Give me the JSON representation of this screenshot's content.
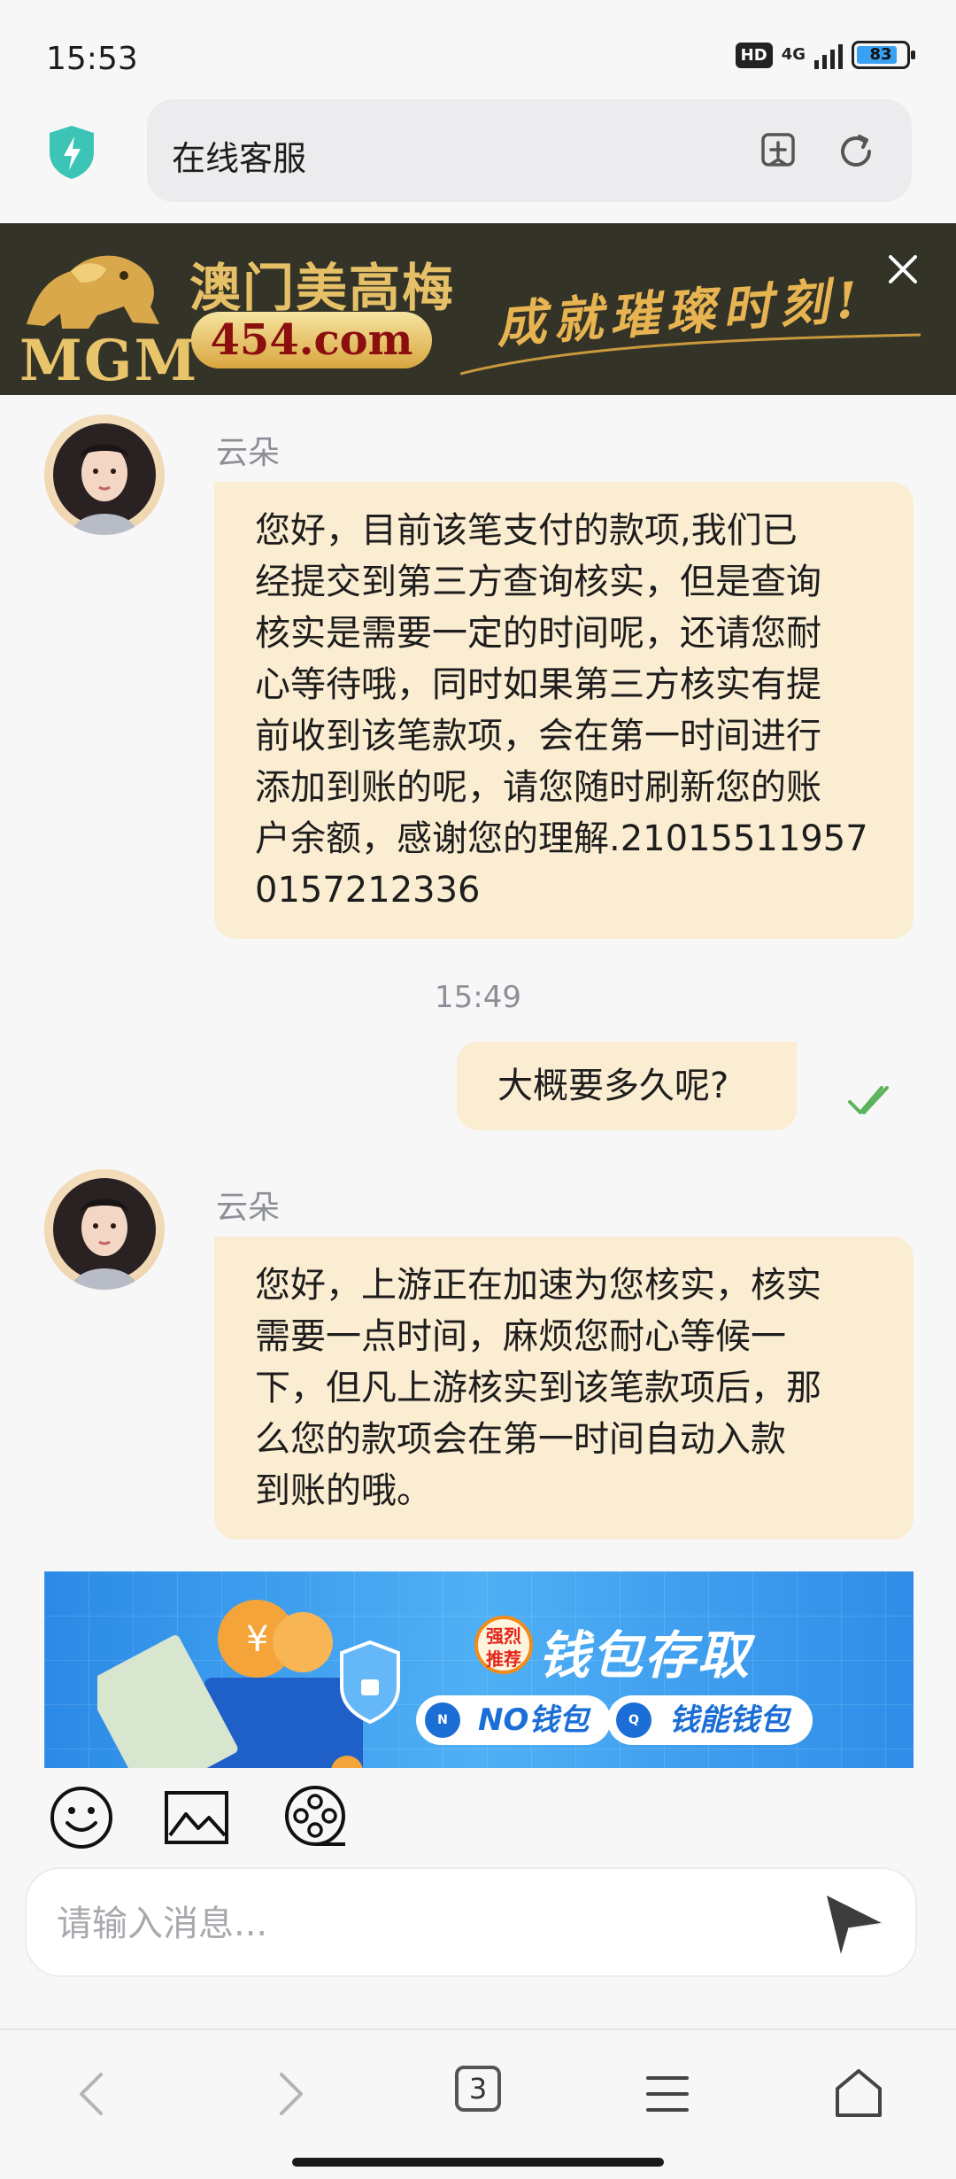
{
  "status_bar": {
    "time": "15:53",
    "hd": "HD",
    "network": "4G",
    "battery": "83"
  },
  "address_bar": {
    "title": "在线客服",
    "icons": [
      "shield-bolt-icon",
      "add-bookmark-icon",
      "reload-icon"
    ]
  },
  "top_banner": {
    "brand": "MGM",
    "cn_name": "澳门美高梅",
    "url": "454.com",
    "slogan": "成就璀璨时刻!",
    "accent": "#e6c067"
  },
  "chat": {
    "messages": [
      {
        "sender": "云朵",
        "direction": "in",
        "text": "您好，目前该笔支付的款项,我们已经提交到第三方查询核实，但是查询核实是需要一定的时间呢，还请您耐心等待哦，同时如果第三方核实有提前收到该笔款项，会在第一时间进行添加到账的呢，请您随时刷新您的账户余额，感谢您的理解.21015511957 0157212336"
      },
      {
        "timestamp": "15:49"
      },
      {
        "direction": "out",
        "text": "大概要多久呢?",
        "status": "read"
      },
      {
        "sender": "云朵",
        "direction": "in",
        "text": "您好，上游正在加速为您核实，核实需要一点时间，麻烦您耐心等候一下，但凡上游核实到该笔款项后，那么您的款项会在第一时间自动入款到账的哦。"
      }
    ],
    "lines_msg1": [
      "您好，目前该笔支付的款项,我们已",
      "经提交到第三方查询核实，但是查询",
      "核实是需要一定的时间呢，还请您耐",
      "心等待哦，同时如果第三方核实有提",
      "前收到该笔款项，会在第一时间进行",
      "添加到账的呢，请您随时刷新您的账",
      "户余额，感谢您的理解.21015511957",
      "0157212336"
    ],
    "lines_msg2": [
      "您好，上游正在加速为您核实，核实",
      "需要一点时间，麻烦您耐心等候一",
      "下，但凡上游核实到该笔款项后，那",
      "么您的款项会在第一时间自动入款",
      "到账的哦。"
    ]
  },
  "ad_card": {
    "badge": "强烈推荐",
    "title": "钱包存取",
    "pills": [
      "NO钱包",
      "钱能钱包"
    ],
    "bg": "#2b8ae6"
  },
  "composer": {
    "placeholder": "请输入消息...",
    "tools": [
      "emoji-icon",
      "image-icon",
      "video-reel-icon"
    ]
  },
  "bottom_nav": {
    "tab_count": "3"
  },
  "colors": {
    "bubble": "#fbedd2",
    "read_check": "#5bb35b",
    "page_bg": "#f7f7f8"
  }
}
